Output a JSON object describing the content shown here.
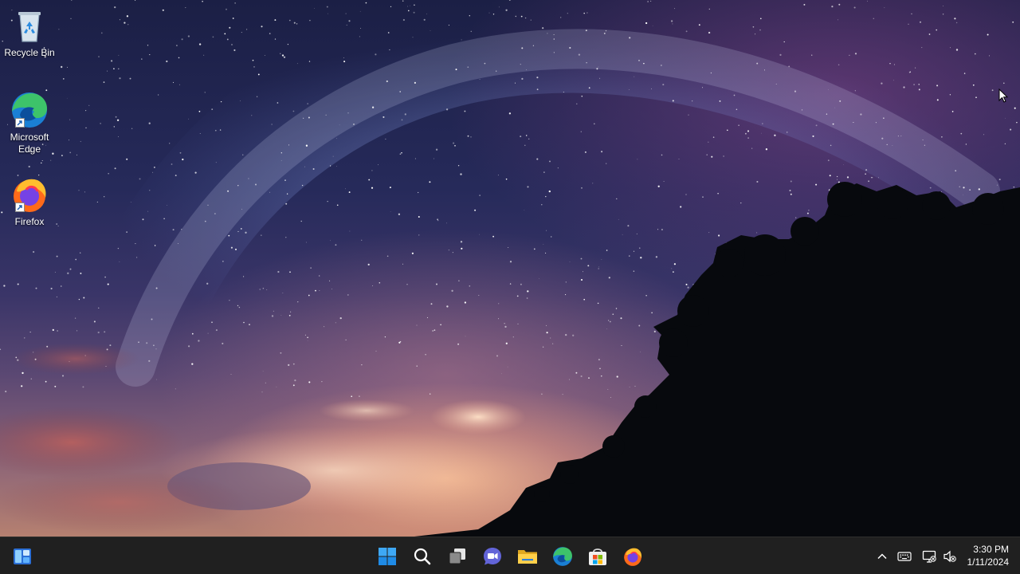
{
  "desktop": {
    "icons": [
      {
        "label": "Recycle Bin",
        "icon": "recycle-bin-icon"
      },
      {
        "label": "Microsoft Edge",
        "icon": "edge-icon"
      },
      {
        "label": "Firefox",
        "icon": "firefox-icon"
      }
    ]
  },
  "taskbar": {
    "widgets_icon": "widgets-icon",
    "pinned": [
      {
        "name": "Start",
        "icon": "windows-start-icon"
      },
      {
        "name": "Search",
        "icon": "search-icon"
      },
      {
        "name": "Task View",
        "icon": "task-view-icon"
      },
      {
        "name": "Chat",
        "icon": "teams-chat-icon"
      },
      {
        "name": "File Explorer",
        "icon": "file-explorer-icon"
      },
      {
        "name": "Microsoft Edge",
        "icon": "edge-icon"
      },
      {
        "name": "Microsoft Store",
        "icon": "store-icon"
      },
      {
        "name": "Firefox",
        "icon": "firefox-icon"
      }
    ],
    "tray": {
      "icons": [
        "chevron-up-icon",
        "keyboard-icon",
        "network-disconnected-icon",
        "volume-muted-icon"
      ],
      "time": "3:30 PM",
      "date": "1/11/2024"
    }
  },
  "colors": {
    "taskbar_bg": "#202020",
    "windows_blue": "#0078d4"
  }
}
